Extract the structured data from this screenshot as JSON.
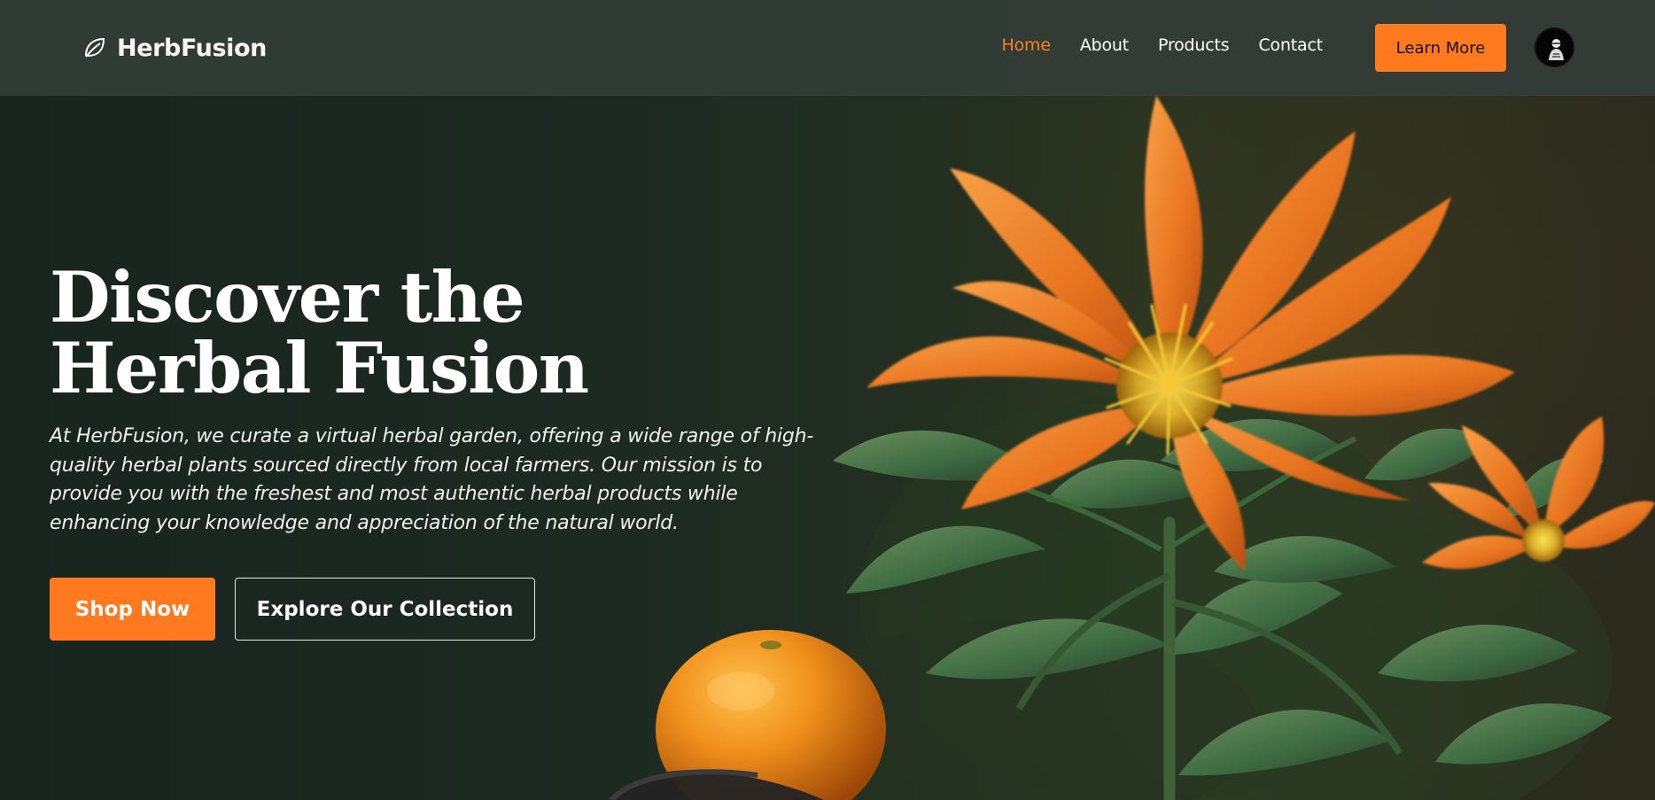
{
  "header": {
    "brand_name": "HerbFusion",
    "brand_icon": "leaf-icon",
    "nav_items": [
      {
        "label": "Home",
        "active": true
      },
      {
        "label": "About",
        "active": false
      },
      {
        "label": "Products",
        "active": false
      },
      {
        "label": "Contact",
        "active": false
      }
    ],
    "learn_more_label": "Learn More",
    "avatar_icon": "avatar-icon"
  },
  "hero": {
    "title": "Discover the\nHerbal Fusion",
    "description": "At HerbFusion, we curate a virtual herbal garden, offering a wide range of high-quality herbal plants sourced directly from local farmers. Our mission is to provide you with the freshest and most authentic herbal products while enhancing your knowledge and appreciation of the natural world.",
    "primary_button": "Shop Now",
    "secondary_button": "Explore Our Collection"
  },
  "colors": {
    "accent": "#ff7a1f",
    "header_background": "#333d37",
    "hero_background": "#1d2a22",
    "text": "#ffffff"
  }
}
